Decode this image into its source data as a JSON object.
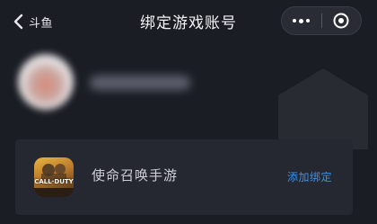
{
  "navbar": {
    "back_label": "斗鱼",
    "title": "绑定游戏账号",
    "more_icon": "more-dots-icon",
    "close_icon": "mini-program-close-icon"
  },
  "profile": {
    "avatar": "blurred-avatar",
    "nickname_blurred": true
  },
  "game_card": {
    "game_icon_text": "CALL·DUTY",
    "game_name": "使命召唤手游",
    "bind_label": "添加绑定"
  },
  "colors": {
    "background": "#1b1d25",
    "card": "#262831",
    "accent": "#3f8fe0",
    "text_primary": "#f2f2f5",
    "text_secondary": "#cfd0d6"
  }
}
